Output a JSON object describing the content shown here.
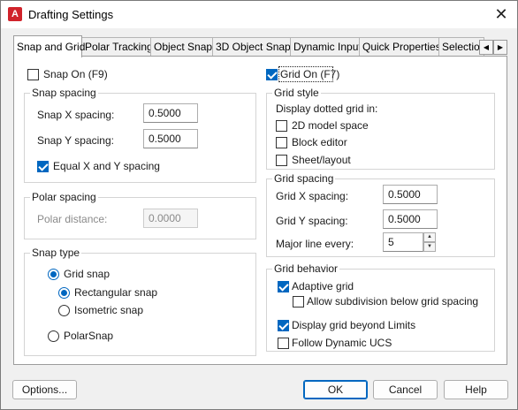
{
  "window": {
    "title": "Drafting Settings",
    "app_icon_letter": "A"
  },
  "tabs": [
    "Snap and Grid",
    "Polar Tracking",
    "Object Snap",
    "3D Object Snap",
    "Dynamic Input",
    "Quick Properties",
    "Selection"
  ],
  "tab_scroll": {
    "left": "◀",
    "right": "▶"
  },
  "snap_on": {
    "label": "Snap On (F9)",
    "checked": false
  },
  "grid_on": {
    "label": "Grid On (F7)",
    "checked": true
  },
  "snap_spacing": {
    "title": "Snap spacing",
    "x_label": "Snap X spacing:",
    "x_value": "0.5000",
    "y_label": "Snap Y spacing:",
    "y_value": "0.5000",
    "equal_label": "Equal X and Y spacing"
  },
  "polar_spacing": {
    "title": "Polar spacing",
    "distance_label": "Polar distance:",
    "distance_value": "0.0000"
  },
  "snap_type": {
    "title": "Snap type",
    "grid_snap": "Grid snap",
    "rectangular": "Rectangular snap",
    "isometric": "Isometric snap",
    "polar": "PolarSnap"
  },
  "grid_style": {
    "title": "Grid style",
    "caption": "Display dotted grid in:",
    "model_space": "2D model space",
    "block_editor": "Block editor",
    "sheet_layout": "Sheet/layout"
  },
  "grid_spacing": {
    "title": "Grid spacing",
    "x_label": "Grid X spacing:",
    "x_value": "0.5000",
    "y_label": "Grid Y spacing:",
    "y_value": "0.5000",
    "major_label": "Major line every:",
    "major_value": "5"
  },
  "grid_behavior": {
    "title": "Grid behavior",
    "adaptive": "Adaptive grid",
    "subdivision": "Allow subdivision below grid spacing",
    "beyond_limits": "Display grid beyond Limits",
    "follow_ucs": "Follow Dynamic UCS"
  },
  "buttons": {
    "options": "Options...",
    "ok": "OK",
    "cancel": "Cancel",
    "help": "Help"
  },
  "colors": {
    "accent": "#0067c0",
    "app_icon": "#d0232b"
  }
}
